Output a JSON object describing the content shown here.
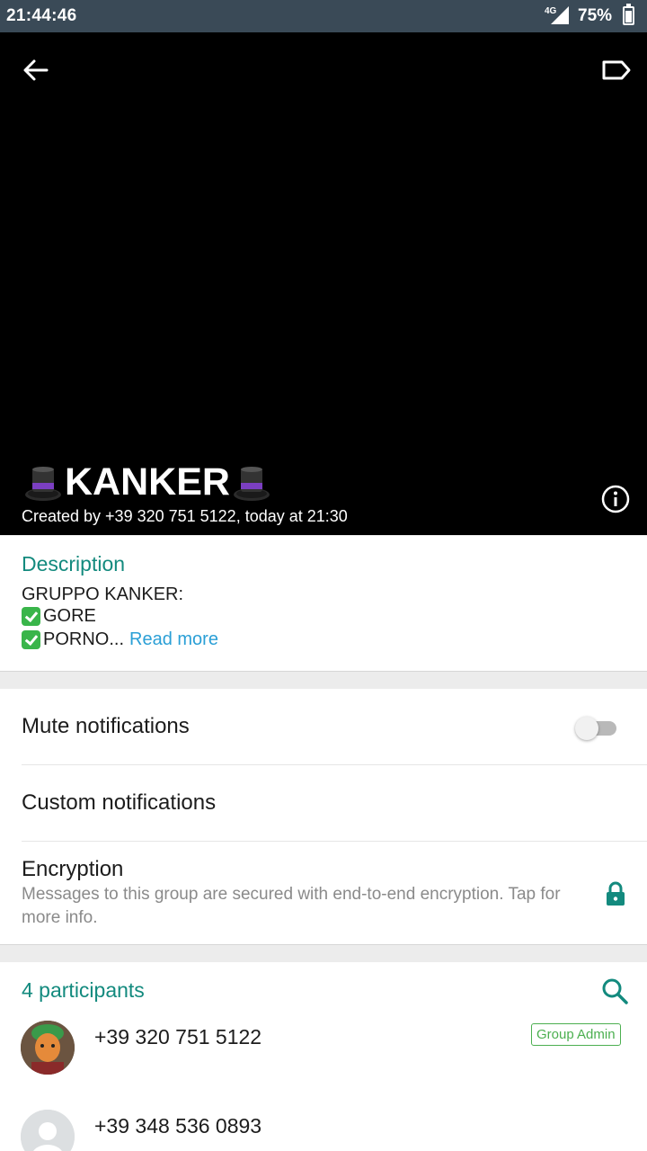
{
  "status_bar": {
    "time": "21:44:46",
    "network": "4G",
    "battery": "75%",
    "battery_level": 0.75
  },
  "header": {
    "group_name": "KANKER",
    "group_emoji": "top-hat-icon",
    "created": "Created by +39 320 751 5122, today at 21:30"
  },
  "description": {
    "heading": "Description",
    "line1": "GRUPPO KANKER:",
    "line2": "GORE",
    "line3": "PORNO...",
    "read_more": "Read more"
  },
  "settings": {
    "mute_label": "Mute notifications",
    "mute_on": false,
    "custom_label": "Custom notifications",
    "encryption_label": "Encryption",
    "encryption_sub": "Messages to this group are secured with end-to-end encryption. Tap for more info."
  },
  "participants": {
    "heading": "4 participants",
    "members": [
      {
        "number": "+39 320 751 5122",
        "badge": "Group Admin"
      },
      {
        "number": "+39 348 536 0893"
      }
    ]
  },
  "colors": {
    "accent": "#138a7e",
    "status_bar": "#3a4a57",
    "link": "#2a9fd6",
    "admin_badge": "#4caf50"
  }
}
